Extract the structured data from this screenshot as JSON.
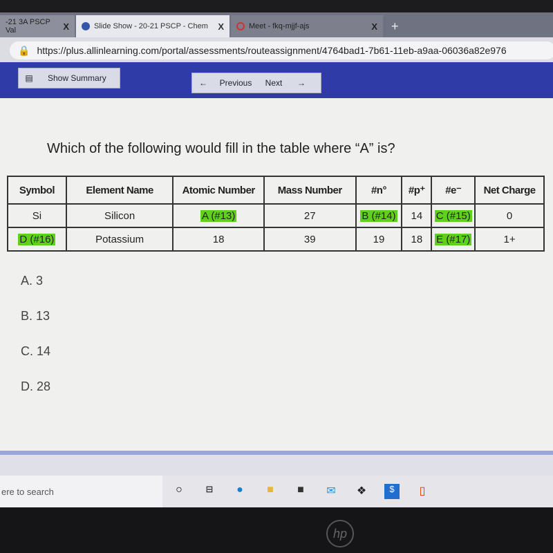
{
  "browser": {
    "tabs": [
      {
        "label": "-21 3A PSCP Val",
        "active": false
      },
      {
        "label": "Slide Show - 20-21 PSCP - Chem",
        "active": true
      },
      {
        "label": "Meet - fkq-mjjf-ajs",
        "active": false
      }
    ],
    "close_glyph": "X",
    "new_tab_glyph": "+",
    "url": "https://plus.allinlearning.com/portal/assessments/routeassignment/4764bad1-7b61-11eb-a9aa-06036a82e976"
  },
  "toolbar": {
    "show_summary": "Show Summary",
    "previous": "Previous",
    "next": "Next",
    "accent": "#2f3ba6"
  },
  "question": "Which of the following would fill in the table where “A” is?",
  "table": {
    "headers": [
      "Symbol",
      "Element Name",
      "Atomic Number",
      "Mass Number",
      "#n°",
      "#p⁺",
      "#e⁻",
      "Net Charge"
    ],
    "rows": [
      [
        {
          "v": "Si"
        },
        {
          "v": "Silicon"
        },
        {
          "v": "A (#13)",
          "hl": true
        },
        {
          "v": "27"
        },
        {
          "v": "B (#14)",
          "hl": true
        },
        {
          "v": "14"
        },
        {
          "v": "C (#15)",
          "hl": true
        },
        {
          "v": "0"
        }
      ],
      [
        {
          "v": "D (#16)",
          "hl": true
        },
        {
          "v": "Potassium"
        },
        {
          "v": "18"
        },
        {
          "v": "39"
        },
        {
          "v": "19"
        },
        {
          "v": "18"
        },
        {
          "v": "E (#17)",
          "hl": true
        },
        {
          "v": "1+"
        }
      ]
    ],
    "highlight_color": "#5fd11c"
  },
  "answers": [
    "A.  3",
    "B.  13",
    "C.  14",
    "D.  28"
  ],
  "taskbar": {
    "search_placeholder": "ere to search",
    "icons": [
      "cortana-icon",
      "task-view-icon",
      "edge-icon",
      "file-explorer-icon",
      "store-icon",
      "mail-icon",
      "dropbox-icon",
      "app-icon",
      "office-icon"
    ]
  },
  "brand": "hp"
}
